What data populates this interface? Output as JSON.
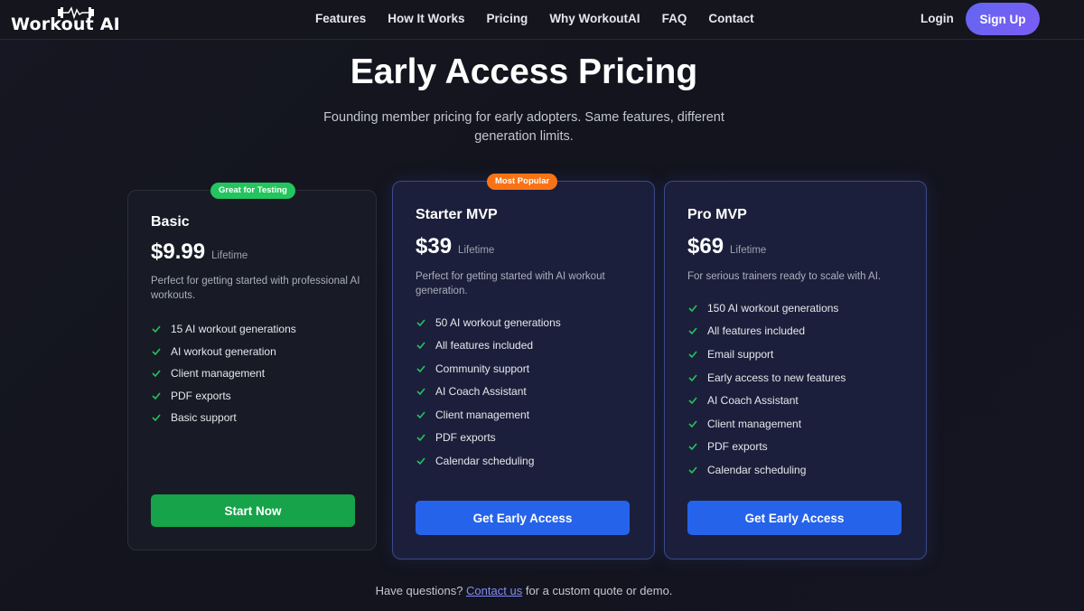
{
  "header": {
    "logo_text": "Workout AI",
    "nav": [
      "Features",
      "How It Works",
      "Pricing",
      "Why WorkoutAI",
      "FAQ",
      "Contact"
    ],
    "login_label": "Login",
    "signup_label": "Sign Up"
  },
  "hero": {
    "title": "Early Access Pricing",
    "subtitle": "Founding member pricing for early adopters. Same features, different generation limits."
  },
  "plans": [
    {
      "badge": "Great for Testing",
      "name": "Basic",
      "price": "$9.99",
      "period": "Lifetime",
      "description": "Perfect for getting started with professional AI workouts.",
      "features": [
        "15 AI workout generations",
        "AI workout generation",
        "Client management",
        "PDF exports",
        "Basic support"
      ],
      "cta": "Start Now"
    },
    {
      "badge": "Most Popular",
      "name": "Starter MVP",
      "price": "$39",
      "period": "Lifetime",
      "description": "Perfect for getting started with AI workout generation.",
      "features": [
        "50 AI workout generations",
        "All features included",
        "Community support",
        "AI Coach Assistant",
        "Client management",
        "PDF exports",
        "Calendar scheduling"
      ],
      "cta": "Get Early Access"
    },
    {
      "name": "Pro MVP",
      "price": "$69",
      "period": "Lifetime",
      "description": "For serious trainers ready to scale with AI.",
      "features": [
        "150 AI workout generations",
        "All features included",
        "Email support",
        "Early access to new features",
        "AI Coach Assistant",
        "Client management",
        "PDF exports",
        "Calendar scheduling"
      ],
      "cta": "Get Early Access"
    }
  ],
  "footer": {
    "prefix": "Have questions?",
    "link": "Contact us",
    "suffix": "for a custom quote or demo."
  },
  "colors": {
    "accent_green": "#22c55e",
    "accent_orange": "#f97316",
    "button_blue": "#2563eb",
    "signup_purple": "#6366f1"
  }
}
